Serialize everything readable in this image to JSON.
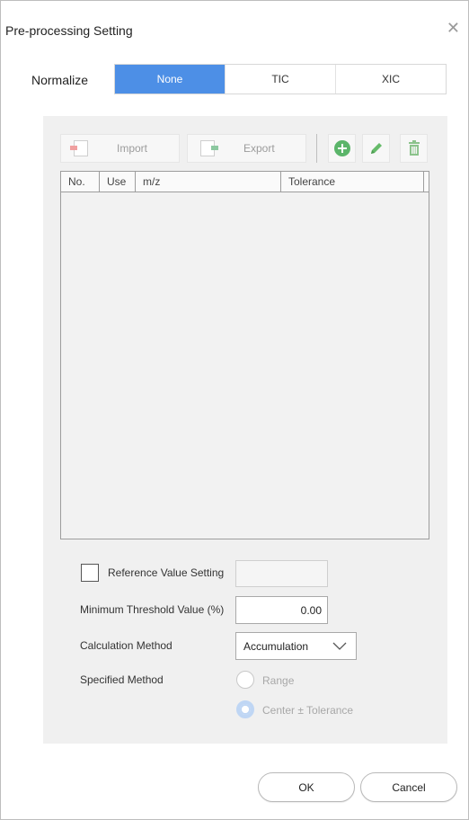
{
  "dialog": {
    "title": "Pre-processing Setting",
    "close_glyph": "✕"
  },
  "normalize": {
    "label": "Normalize",
    "options": [
      {
        "label": "None",
        "active": true
      },
      {
        "label": "TIC",
        "active": false
      },
      {
        "label": "XIC",
        "active": false
      }
    ]
  },
  "toolbar": {
    "import_label": "Import",
    "export_label": "Export"
  },
  "table": {
    "columns": [
      "No.",
      "Use",
      "m/z",
      "Tolerance"
    ],
    "rows": []
  },
  "form": {
    "reference_label": "Reference Value Setting",
    "reference_value": "",
    "threshold_label": "Minimum Threshold Value (%)",
    "threshold_value": "0.00",
    "calc_label": "Calculation Method",
    "calc_value": "Accumulation",
    "specified_label": "Specified Method",
    "range_label": "Range",
    "center_label": "Center ± Tolerance"
  },
  "buttons": {
    "ok_label": "OK",
    "cancel_label": "Cancel"
  },
  "colors": {
    "accent": "#4d8fe6",
    "panel": "#f0f0f0",
    "add_green": "#5bb56a",
    "edit_green": "#66bb6a",
    "delete_green": "#8bc38b"
  }
}
